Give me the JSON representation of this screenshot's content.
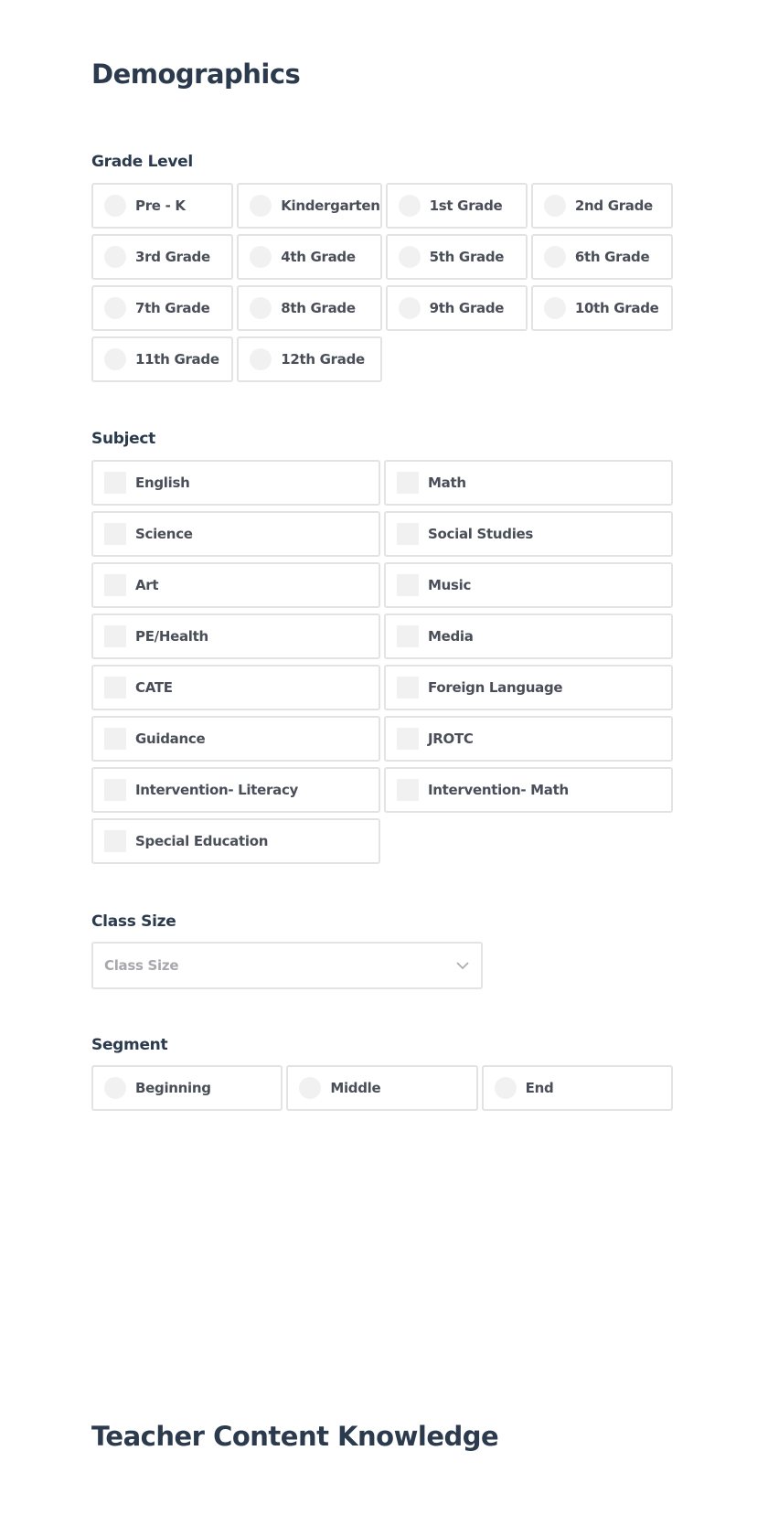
{
  "demographics": {
    "title": "Demographics",
    "grade_level": {
      "label": "Grade Level",
      "options": [
        "Pre - K",
        "Kindergarten",
        "1st Grade",
        "2nd Grade",
        "3rd Grade",
        "4th Grade",
        "5th Grade",
        "6th Grade",
        "7th Grade",
        "8th Grade",
        "9th Grade",
        "10th Grade",
        "11th Grade",
        "12th Grade"
      ]
    },
    "subject": {
      "label": "Subject",
      "options": [
        "English",
        "Math",
        "Science",
        "Social Studies",
        "Art",
        "Music",
        "PE/Health",
        "Media",
        "CATE",
        "Foreign Language",
        "Guidance",
        "JROTC",
        "Intervention- Literacy",
        "Intervention- Math",
        "Special Education"
      ]
    },
    "class_size": {
      "label": "Class Size",
      "placeholder": "Class Size",
      "icon": "chevron-down-icon"
    },
    "segment": {
      "label": "Segment",
      "options": [
        "Beginning",
        "Middle",
        "End"
      ]
    }
  },
  "teacher_content_knowledge": {
    "title": "Teacher Content Knowledge"
  },
  "colors": {
    "heading": "#2b3a4d",
    "option_text": "#4a4e58",
    "border": "#e3e3e3",
    "control_fill": "#f1f1f1",
    "placeholder": "#a8a8ad"
  }
}
